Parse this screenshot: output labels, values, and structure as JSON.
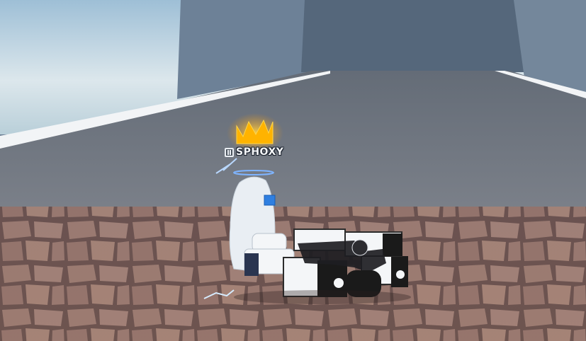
{
  "scene": {
    "type": "roblox-game-view",
    "player": {
      "display_name": "SPHOXY",
      "accessories": [
        "crown-icon",
        "halo-icon"
      ]
    },
    "colors": {
      "sky_top": "#9fc3da",
      "sky_bottom": "#dfe9ee",
      "wall": "#6a7d92",
      "road": "#747b85",
      "road_stripe": "#f2f4f6",
      "crown": "#ffb300",
      "stone_floor": "#9a7a70"
    }
  }
}
